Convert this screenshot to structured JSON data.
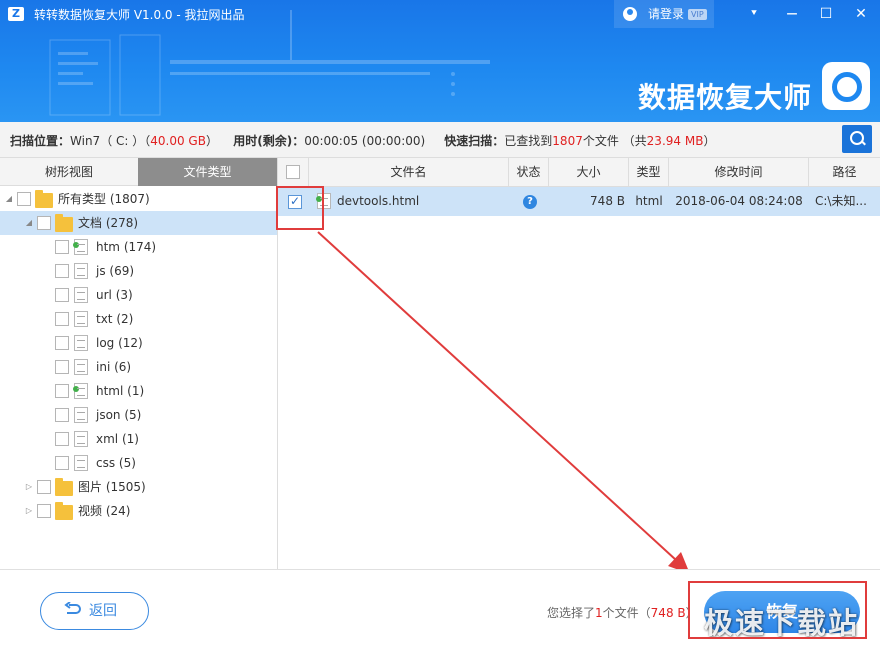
{
  "app": {
    "title": "转转数据恢复大师 V1.0.0 - 我拉网出品",
    "logo_letter": "Z",
    "login_label": "请登录",
    "vip_badge": "VIP",
    "brand_name": "数据恢复大师"
  },
  "window_controls": {
    "menu_glyph": "⯆",
    "minimize_glyph": "—",
    "maximize_glyph": "☐",
    "close_glyph": "✕"
  },
  "scan_info": {
    "location_label": "扫描位置：",
    "location_value_prefix": "Win7（ C: ）（",
    "location_size": "40.00 GB",
    "location_value_suffix": "）",
    "time_label": "用时(剩余)：",
    "time_value": "00:00:05 (00:00:00)",
    "scan_mode_label": "快速扫描：",
    "found_prefix": "已查找到",
    "found_count": "1807",
    "found_suffix": "个文件 （共",
    "found_size": "23.94 MB",
    "found_close": "）"
  },
  "tabs": {
    "tree_view": "树形视图",
    "file_type": "文件类型"
  },
  "tree": [
    {
      "label": "所有类型 (1807)",
      "icon": "folder-icon",
      "level": 0,
      "arrow": "◢"
    },
    {
      "label": "文档 (278)",
      "icon": "folder-icon",
      "level": 1,
      "arrow": "◢",
      "selected": true
    },
    {
      "label": "htm (174)",
      "icon": "html-file-icon",
      "level": 2
    },
    {
      "label": "js (69)",
      "icon": "js-file-icon",
      "level": 2
    },
    {
      "label": "url (3)",
      "icon": "file-icon",
      "level": 2
    },
    {
      "label": "txt (2)",
      "icon": "file-icon",
      "level": 2
    },
    {
      "label": "log (12)",
      "icon": "file-icon",
      "level": 2
    },
    {
      "label": "ini (6)",
      "icon": "settings-file-icon",
      "level": 2
    },
    {
      "label": "html (1)",
      "icon": "html-file-icon",
      "level": 2
    },
    {
      "label": "json (5)",
      "icon": "file-icon",
      "level": 2
    },
    {
      "label": "xml (1)",
      "icon": "xml-file-icon",
      "level": 2
    },
    {
      "label": "css (5)",
      "icon": "css-file-icon",
      "level": 2
    },
    {
      "label": "图片 (1505)",
      "icon": "folder-icon",
      "level": 1,
      "arrow": "▷"
    },
    {
      "label": "视频 (24)",
      "icon": "folder-icon",
      "level": 1,
      "arrow": "▷"
    }
  ],
  "table": {
    "columns": [
      "文件名",
      "状态",
      "大小",
      "类型",
      "修改时间",
      "路径"
    ],
    "rows": [
      {
        "name": "devtools.html",
        "status_icon": "question-icon",
        "status_glyph": "?",
        "size": "748 B",
        "type": "html",
        "modified": "2018-06-04 08:24:08",
        "path": "C:\\未知..."
      }
    ]
  },
  "footer": {
    "back_label": "返回",
    "selected_prefix": "您选择了",
    "selected_count": "1",
    "selected_middle": "个文件（",
    "selected_size": "748 B",
    "selected_suffix": "）",
    "recover_label": "恢复",
    "watermark": "极速下载站"
  },
  "colors": {
    "header_blue": "#1e88f0",
    "accent_red": "#e02020",
    "selection": "#cde3f8",
    "highlight_box": "#e03c3c"
  }
}
